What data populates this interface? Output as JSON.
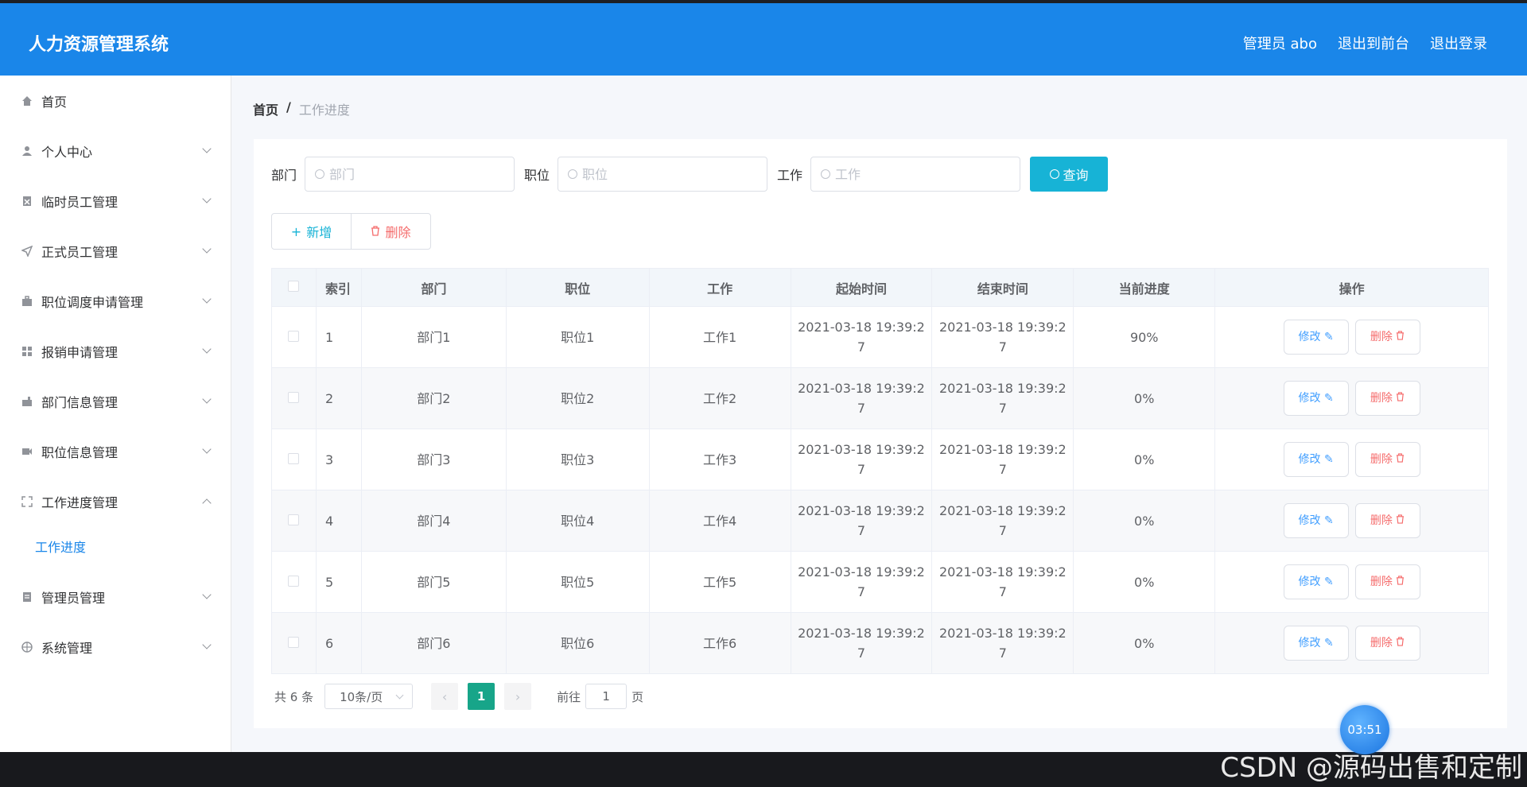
{
  "header": {
    "app_title": "人力资源管理系统",
    "admin_label": "管理员 abo",
    "front_link": "退出到前台",
    "logout_link": "退出登录"
  },
  "sidebar": {
    "items": [
      {
        "label": "首页",
        "icon": "home-icon"
      },
      {
        "label": "个人中心",
        "icon": "user-icon"
      },
      {
        "label": "临时员工管理",
        "icon": "clipboard-icon"
      },
      {
        "label": "正式员工管理",
        "icon": "send-icon"
      },
      {
        "label": "职位调度申请管理",
        "icon": "briefcase-icon"
      },
      {
        "label": "报销申请管理",
        "icon": "grid-icon"
      },
      {
        "label": "部门信息管理",
        "icon": "building-icon"
      },
      {
        "label": "职位信息管理",
        "icon": "video-icon"
      },
      {
        "label": "工作进度管理",
        "icon": "fullscreen-icon"
      },
      {
        "label": "管理员管理",
        "icon": "document-icon"
      },
      {
        "label": "系统管理",
        "icon": "globe-icon"
      }
    ],
    "active_sub": "工作进度"
  },
  "breadcrumb": {
    "home": "首页",
    "separator": "/",
    "current": "工作进度"
  },
  "search": {
    "dept_label": "部门",
    "dept_placeholder": "部门",
    "position_label": "职位",
    "position_placeholder": "职位",
    "work_label": "工作",
    "work_placeholder": "工作",
    "query_button": "查询"
  },
  "actions": {
    "add_label": "新增",
    "delete_label": "删除"
  },
  "table": {
    "headers": [
      "索引",
      "部门",
      "职位",
      "工作",
      "起始时间",
      "结束时间",
      "当前进度",
      "操作"
    ],
    "rows": [
      {
        "index": "1",
        "dept": "部门1",
        "position": "职位1",
        "work": "工作1",
        "start_a": "2021-03-18 19:39:2",
        "start_b": "7",
        "end_a": "2021-03-18 19:39:2",
        "end_b": "7",
        "progress": "90%"
      },
      {
        "index": "2",
        "dept": "部门2",
        "position": "职位2",
        "work": "工作2",
        "start_a": "2021-03-18 19:39:2",
        "start_b": "7",
        "end_a": "2021-03-18 19:39:2",
        "end_b": "7",
        "progress": "0%"
      },
      {
        "index": "3",
        "dept": "部门3",
        "position": "职位3",
        "work": "工作3",
        "start_a": "2021-03-18 19:39:2",
        "start_b": "7",
        "end_a": "2021-03-18 19:39:2",
        "end_b": "7",
        "progress": "0%"
      },
      {
        "index": "4",
        "dept": "部门4",
        "position": "职位4",
        "work": "工作4",
        "start_a": "2021-03-18 19:39:2",
        "start_b": "7",
        "end_a": "2021-03-18 19:39:2",
        "end_b": "7",
        "progress": "0%"
      },
      {
        "index": "5",
        "dept": "部门5",
        "position": "职位5",
        "work": "工作5",
        "start_a": "2021-03-18 19:39:2",
        "start_b": "7",
        "end_a": "2021-03-18 19:39:2",
        "end_b": "7",
        "progress": "0%"
      },
      {
        "index": "6",
        "dept": "部门6",
        "position": "职位6",
        "work": "工作6",
        "start_a": "2021-03-18 19:39:2",
        "start_b": "7",
        "end_a": "2021-03-18 19:39:2",
        "end_b": "7",
        "progress": "0%"
      }
    ],
    "edit_label": "修改",
    "row_delete_label": "删除"
  },
  "pagination": {
    "total": "共 6 条",
    "page_size": "10条/页",
    "current_page": "1",
    "goto_label": "前往",
    "goto_value": "1",
    "page_suffix": "页"
  },
  "overlay": {
    "timer": "03:51",
    "watermark": "CSDN @源码出售和定制"
  },
  "colors": {
    "header_bg": "#1a86e9",
    "query_btn": "#17b3d6",
    "active_page": "#17a589",
    "danger": "#f56c6c",
    "primary": "#409eff"
  }
}
